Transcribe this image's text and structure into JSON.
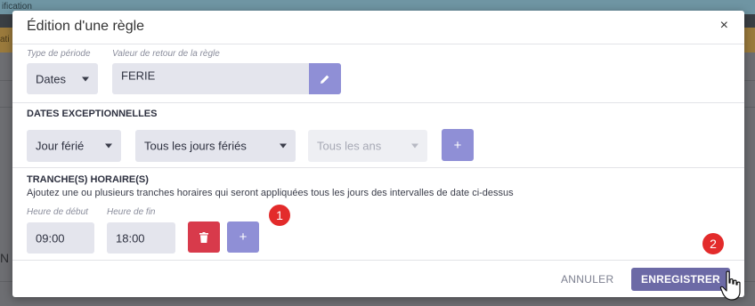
{
  "background": {
    "topbar_text": "ification",
    "orange_text": "ati",
    "side_letter": "N"
  },
  "modal": {
    "title": "Édition d'une règle",
    "close": "×"
  },
  "period_type": {
    "label": "Type de période",
    "value": "Dates"
  },
  "return_value": {
    "label": "Valeur de retour de la règle",
    "value": "FERIE",
    "edit_icon": "pencil-icon"
  },
  "exceptional_dates": {
    "title": "DATES EXCEPTIONNELLES",
    "kind": "Jour férié",
    "holidays": "Tous les jours fériés",
    "years_placeholder": "Tous les ans",
    "add_label": "+"
  },
  "time_slots": {
    "title": "TRANCHE(S) HORAIRE(S)",
    "description": "Ajoutez une ou plusieurs tranches horaires qui seront appliquées tous les jours des intervalles de date ci-dessus",
    "start_label": "Heure de début",
    "end_label": "Heure de fin",
    "start_value": "09:00",
    "end_value": "18:00",
    "delete_icon": "trash-icon",
    "add_label": "+"
  },
  "footer": {
    "cancel": "ANNULER",
    "save": "ENREGISTRER"
  },
  "annotations": {
    "badge_1": "1",
    "badge_2": "2"
  },
  "colors": {
    "accent": "#8f8fd6",
    "primary": "#6c6aa6",
    "danger": "#d83a4b",
    "badge": "#e32b2b"
  }
}
